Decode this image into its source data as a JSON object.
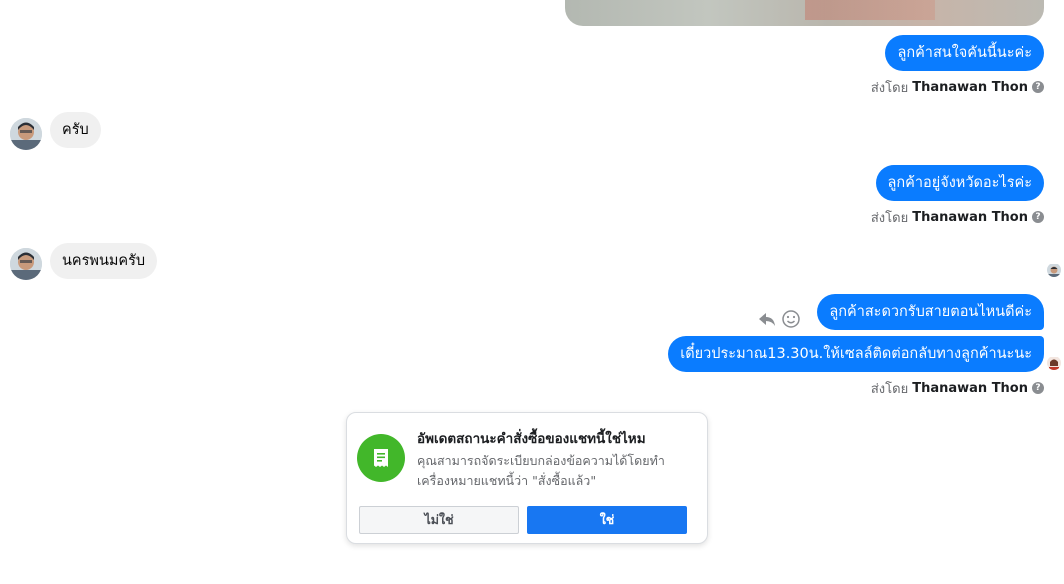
{
  "messages": {
    "out1": "ลูกค้าสนใจคันนี้นะค่ะ",
    "in1": "ครับ",
    "out2": "ลูกค้าอยู่จังหวัดอะไรค่ะ",
    "in2": "นครพนมครับ",
    "out3": "ลูกค้าสะดวกรับสายตอนไหนดีค่ะ",
    "out4": "เดี๋ยวประมาณ13.30น.ให้เซลล์ติดต่อกลับทางลูกค้านะนะ"
  },
  "sent_by": {
    "prefix": "ส่งโดย",
    "name": "Thanawan Thon",
    "help_glyph": "?"
  },
  "order_card": {
    "title": "อัพเดตสถานะคำสั่งซื้อของแชทนี้ใช่ไหม",
    "description": "คุณสามารถจัดระเบียบกล่องข้อความได้โดยทำเครื่องหมายแชทนี้ว่า \"สั่งซื้อแล้ว\"",
    "no_label": "ไม่ใช่",
    "yes_label": "ใช่",
    "icon": "receipt-icon",
    "icon_color": "#42b72a"
  },
  "colors": {
    "outgoing_bubble": "#0a7cff",
    "incoming_bubble": "#f0f0f0",
    "primary_button": "#1877f2"
  },
  "icons": [
    "reply-icon",
    "emoji-icon",
    "help-icon",
    "avatar"
  ]
}
